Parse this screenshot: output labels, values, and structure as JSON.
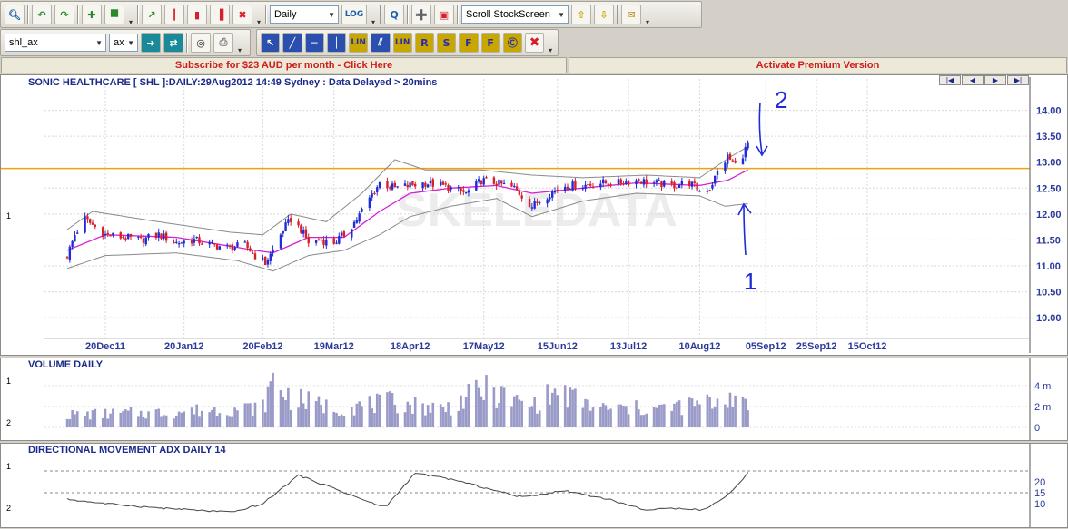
{
  "toolbar1": {
    "period_select": "Daily",
    "log_label": "LOG",
    "scroll_select": "Scroll StockScreen"
  },
  "toolbar2": {
    "symbol_input": "shl_ax",
    "exchange_select": "ax",
    "draw_tools": [
      "LIN",
      "LIN",
      "R",
      "S",
      "F",
      "F"
    ]
  },
  "banners": {
    "subscribe": "Subscribe for $23 AUD per month - Click Here",
    "premium": "Activate Premium Version"
  },
  "price_panel": {
    "title": "SONIC HEALTHCARE [ SHL ]:DAILY:29Aug2012 14:49 Sydney : Data Delayed > 20mins",
    "row_label": "1",
    "watermark": "SKELEDATA",
    "annotations": [
      "2",
      "1"
    ]
  },
  "volume_panel": {
    "title": "VOLUME DAILY",
    "row_labels": [
      "1",
      "2"
    ]
  },
  "adx_panel": {
    "title": "DIRECTIONAL MOVEMENT ADX DAILY 14",
    "row_labels": [
      "1",
      "2"
    ]
  },
  "colors": {
    "up_candle": "#1f2bd6",
    "down_candle": "#d61f2b",
    "ma_line": "#d61fd6",
    "band_line": "#8a8a8a",
    "resistance": "#f0a010",
    "volume_bar": "#9a9ac8",
    "annotation": "#1f2bd6",
    "axis_text": "#2b3a9a"
  },
  "chart_data": [
    {
      "type": "candlestick",
      "title": "SONIC HEALTHCARE [ SHL ]:DAILY:29Aug2012 14:49 Sydney : Data Delayed > 20mins",
      "x_ticks": [
        "20Dec11",
        "20Jan12",
        "20Feb12",
        "19Mar12",
        "18Apr12",
        "17May12",
        "15Jun12",
        "13Jul12",
        "10Aug12",
        "05Sep12",
        "25Sep12",
        "15Oct12"
      ],
      "y_ticks": [
        "10.00",
        "10.50",
        "11.00",
        "11.50",
        "12.00",
        "12.50",
        "13.00",
        "13.50",
        "14.00"
      ],
      "ylim": [
        9.6,
        14.5
      ],
      "horizontal_line": 12.88,
      "close_path": [
        [
          "2011-12-05",
          11.2
        ],
        [
          "2011-12-08",
          11.6
        ],
        [
          "2011-12-12",
          11.9
        ],
        [
          "2011-12-16",
          11.75
        ],
        [
          "2011-12-20",
          11.6
        ],
        [
          "2011-12-27",
          11.55
        ],
        [
          "2012-01-03",
          11.5
        ],
        [
          "2012-01-10",
          11.6
        ],
        [
          "2012-01-17",
          11.45
        ],
        [
          "2012-01-24",
          11.5
        ],
        [
          "2012-01-31",
          11.4
        ],
        [
          "2012-02-07",
          11.35
        ],
        [
          "2012-02-13",
          11.4
        ],
        [
          "2012-02-17",
          11.2
        ],
        [
          "2012-02-21",
          11.05
        ],
        [
          "2012-02-24",
          11.3
        ],
        [
          "2012-02-28",
          11.7
        ],
        [
          "2012-03-02",
          11.9
        ],
        [
          "2012-03-06",
          11.7
        ],
        [
          "2012-03-09",
          11.45
        ],
        [
          "2012-03-13",
          11.5
        ],
        [
          "2012-03-19",
          11.45
        ],
        [
          "2012-03-23",
          11.6
        ],
        [
          "2012-03-28",
          11.9
        ],
        [
          "2012-04-02",
          12.3
        ],
        [
          "2012-04-06",
          12.6
        ],
        [
          "2012-04-12",
          12.5
        ],
        [
          "2012-04-18",
          12.55
        ],
        [
          "2012-04-24",
          12.6
        ],
        [
          "2012-04-30",
          12.55
        ],
        [
          "2012-05-04",
          12.5
        ],
        [
          "2012-05-10",
          12.4
        ],
        [
          "2012-05-16",
          12.65
        ],
        [
          "2012-05-22",
          12.6
        ],
        [
          "2012-05-29",
          12.5
        ],
        [
          "2012-06-05",
          12.15
        ],
        [
          "2012-06-12",
          12.4
        ],
        [
          "2012-06-18",
          12.55
        ],
        [
          "2012-06-25",
          12.55
        ],
        [
          "2012-07-02",
          12.6
        ],
        [
          "2012-07-09",
          12.6
        ],
        [
          "2012-07-16",
          12.65
        ],
        [
          "2012-07-23",
          12.6
        ],
        [
          "2012-07-30",
          12.55
        ],
        [
          "2012-08-06",
          12.6
        ],
        [
          "2012-08-10",
          12.45
        ],
        [
          "2012-08-14",
          12.5
        ],
        [
          "2012-08-17",
          12.8
        ],
        [
          "2012-08-21",
          13.1
        ],
        [
          "2012-08-24",
          12.95
        ],
        [
          "2012-08-27",
          13.15
        ],
        [
          "2012-08-29",
          13.35
        ]
      ],
      "ma_path": [
        [
          "2011-12-05",
          11.3
        ],
        [
          "2011-12-20",
          11.6
        ],
        [
          "2012-01-17",
          11.55
        ],
        [
          "2012-02-17",
          11.3
        ],
        [
          "2012-02-24",
          11.25
        ],
        [
          "2012-03-09",
          11.55
        ],
        [
          "2012-03-23",
          11.55
        ],
        [
          "2012-04-06",
          12.05
        ],
        [
          "2012-04-18",
          12.4
        ],
        [
          "2012-05-04",
          12.5
        ],
        [
          "2012-05-22",
          12.55
        ],
        [
          "2012-06-05",
          12.4
        ],
        [
          "2012-06-25",
          12.5
        ],
        [
          "2012-07-16",
          12.6
        ],
        [
          "2012-08-10",
          12.55
        ],
        [
          "2012-08-21",
          12.65
        ],
        [
          "2012-08-29",
          12.85
        ]
      ],
      "upper_band": [
        [
          "2011-12-05",
          11.7
        ],
        [
          "2011-12-15",
          12.05
        ],
        [
          "2012-01-10",
          11.85
        ],
        [
          "2012-02-07",
          11.65
        ],
        [
          "2012-02-20",
          11.6
        ],
        [
          "2012-03-02",
          12.0
        ],
        [
          "2012-03-16",
          11.85
        ],
        [
          "2012-03-30",
          12.4
        ],
        [
          "2012-04-12",
          13.05
        ],
        [
          "2012-04-24",
          12.85
        ],
        [
          "2012-05-16",
          12.85
        ],
        [
          "2012-06-05",
          12.75
        ],
        [
          "2012-06-25",
          12.7
        ],
        [
          "2012-07-20",
          12.75
        ],
        [
          "2012-08-10",
          12.7
        ],
        [
          "2012-08-22",
          13.1
        ],
        [
          "2012-08-29",
          13.3
        ]
      ],
      "lower_band": [
        [
          "2011-12-05",
          10.95
        ],
        [
          "2011-12-20",
          11.2
        ],
        [
          "2012-01-17",
          11.25
        ],
        [
          "2012-02-10",
          11.1
        ],
        [
          "2012-02-24",
          10.9
        ],
        [
          "2012-03-09",
          11.2
        ],
        [
          "2012-03-23",
          11.3
        ],
        [
          "2012-04-06",
          11.6
        ],
        [
          "2012-04-18",
          11.95
        ],
        [
          "2012-05-04",
          12.15
        ],
        [
          "2012-05-22",
          12.3
        ],
        [
          "2012-06-05",
          11.95
        ],
        [
          "2012-06-25",
          12.25
        ],
        [
          "2012-07-16",
          12.4
        ],
        [
          "2012-08-10",
          12.35
        ],
        [
          "2012-08-20",
          12.15
        ],
        [
          "2012-08-29",
          12.2
        ]
      ]
    },
    {
      "type": "bar",
      "title": "VOLUME DAILY",
      "y_ticks": [
        "0",
        "2 m",
        "4 m"
      ],
      "ylim": [
        0,
        5.2
      ],
      "volume_path": [
        [
          "2011-12-05",
          1.2
        ],
        [
          "2012-01-10",
          1.4
        ],
        [
          "2012-02-20",
          1.9
        ],
        [
          "2012-02-24",
          4.5
        ],
        [
          "2012-03-02",
          2.8
        ],
        [
          "2012-03-20",
          1.8
        ],
        [
          "2012-04-10",
          2.4
        ],
        [
          "2012-05-02",
          1.8
        ],
        [
          "2012-05-17",
          3.6
        ],
        [
          "2012-06-04",
          2.0
        ],
        [
          "2012-06-15",
          3.4
        ],
        [
          "2012-07-01",
          1.8
        ],
        [
          "2012-07-26",
          1.8
        ],
        [
          "2012-08-16",
          2.4
        ],
        [
          "2012-08-24",
          3.2
        ],
        [
          "2012-08-29",
          1.6
        ]
      ]
    },
    {
      "type": "line",
      "title": "DIRECTIONAL MOVEMENT ADX DAILY 14",
      "y_ticks": [
        "10",
        "15",
        "20"
      ],
      "ylim": [
        5,
        30
      ],
      "reference_lines": [
        15,
        25
      ],
      "adx_path": [
        [
          "2011-12-05",
          12
        ],
        [
          "2011-12-20",
          10
        ],
        [
          "2012-01-10",
          8
        ],
        [
          "2012-02-08",
          6
        ],
        [
          "2012-02-20",
          10
        ],
        [
          "2012-03-05",
          23
        ],
        [
          "2012-03-19",
          17
        ],
        [
          "2012-03-30",
          12
        ],
        [
          "2012-04-08",
          8
        ],
        [
          "2012-04-20",
          24
        ],
        [
          "2012-05-05",
          21
        ],
        [
          "2012-05-18",
          17
        ],
        [
          "2012-06-01",
          13
        ],
        [
          "2012-06-18",
          16
        ],
        [
          "2012-07-05",
          12
        ],
        [
          "2012-07-20",
          7
        ],
        [
          "2012-08-02",
          8
        ],
        [
          "2012-08-12",
          7
        ],
        [
          "2012-08-22",
          15
        ],
        [
          "2012-08-29",
          24
        ]
      ]
    }
  ]
}
